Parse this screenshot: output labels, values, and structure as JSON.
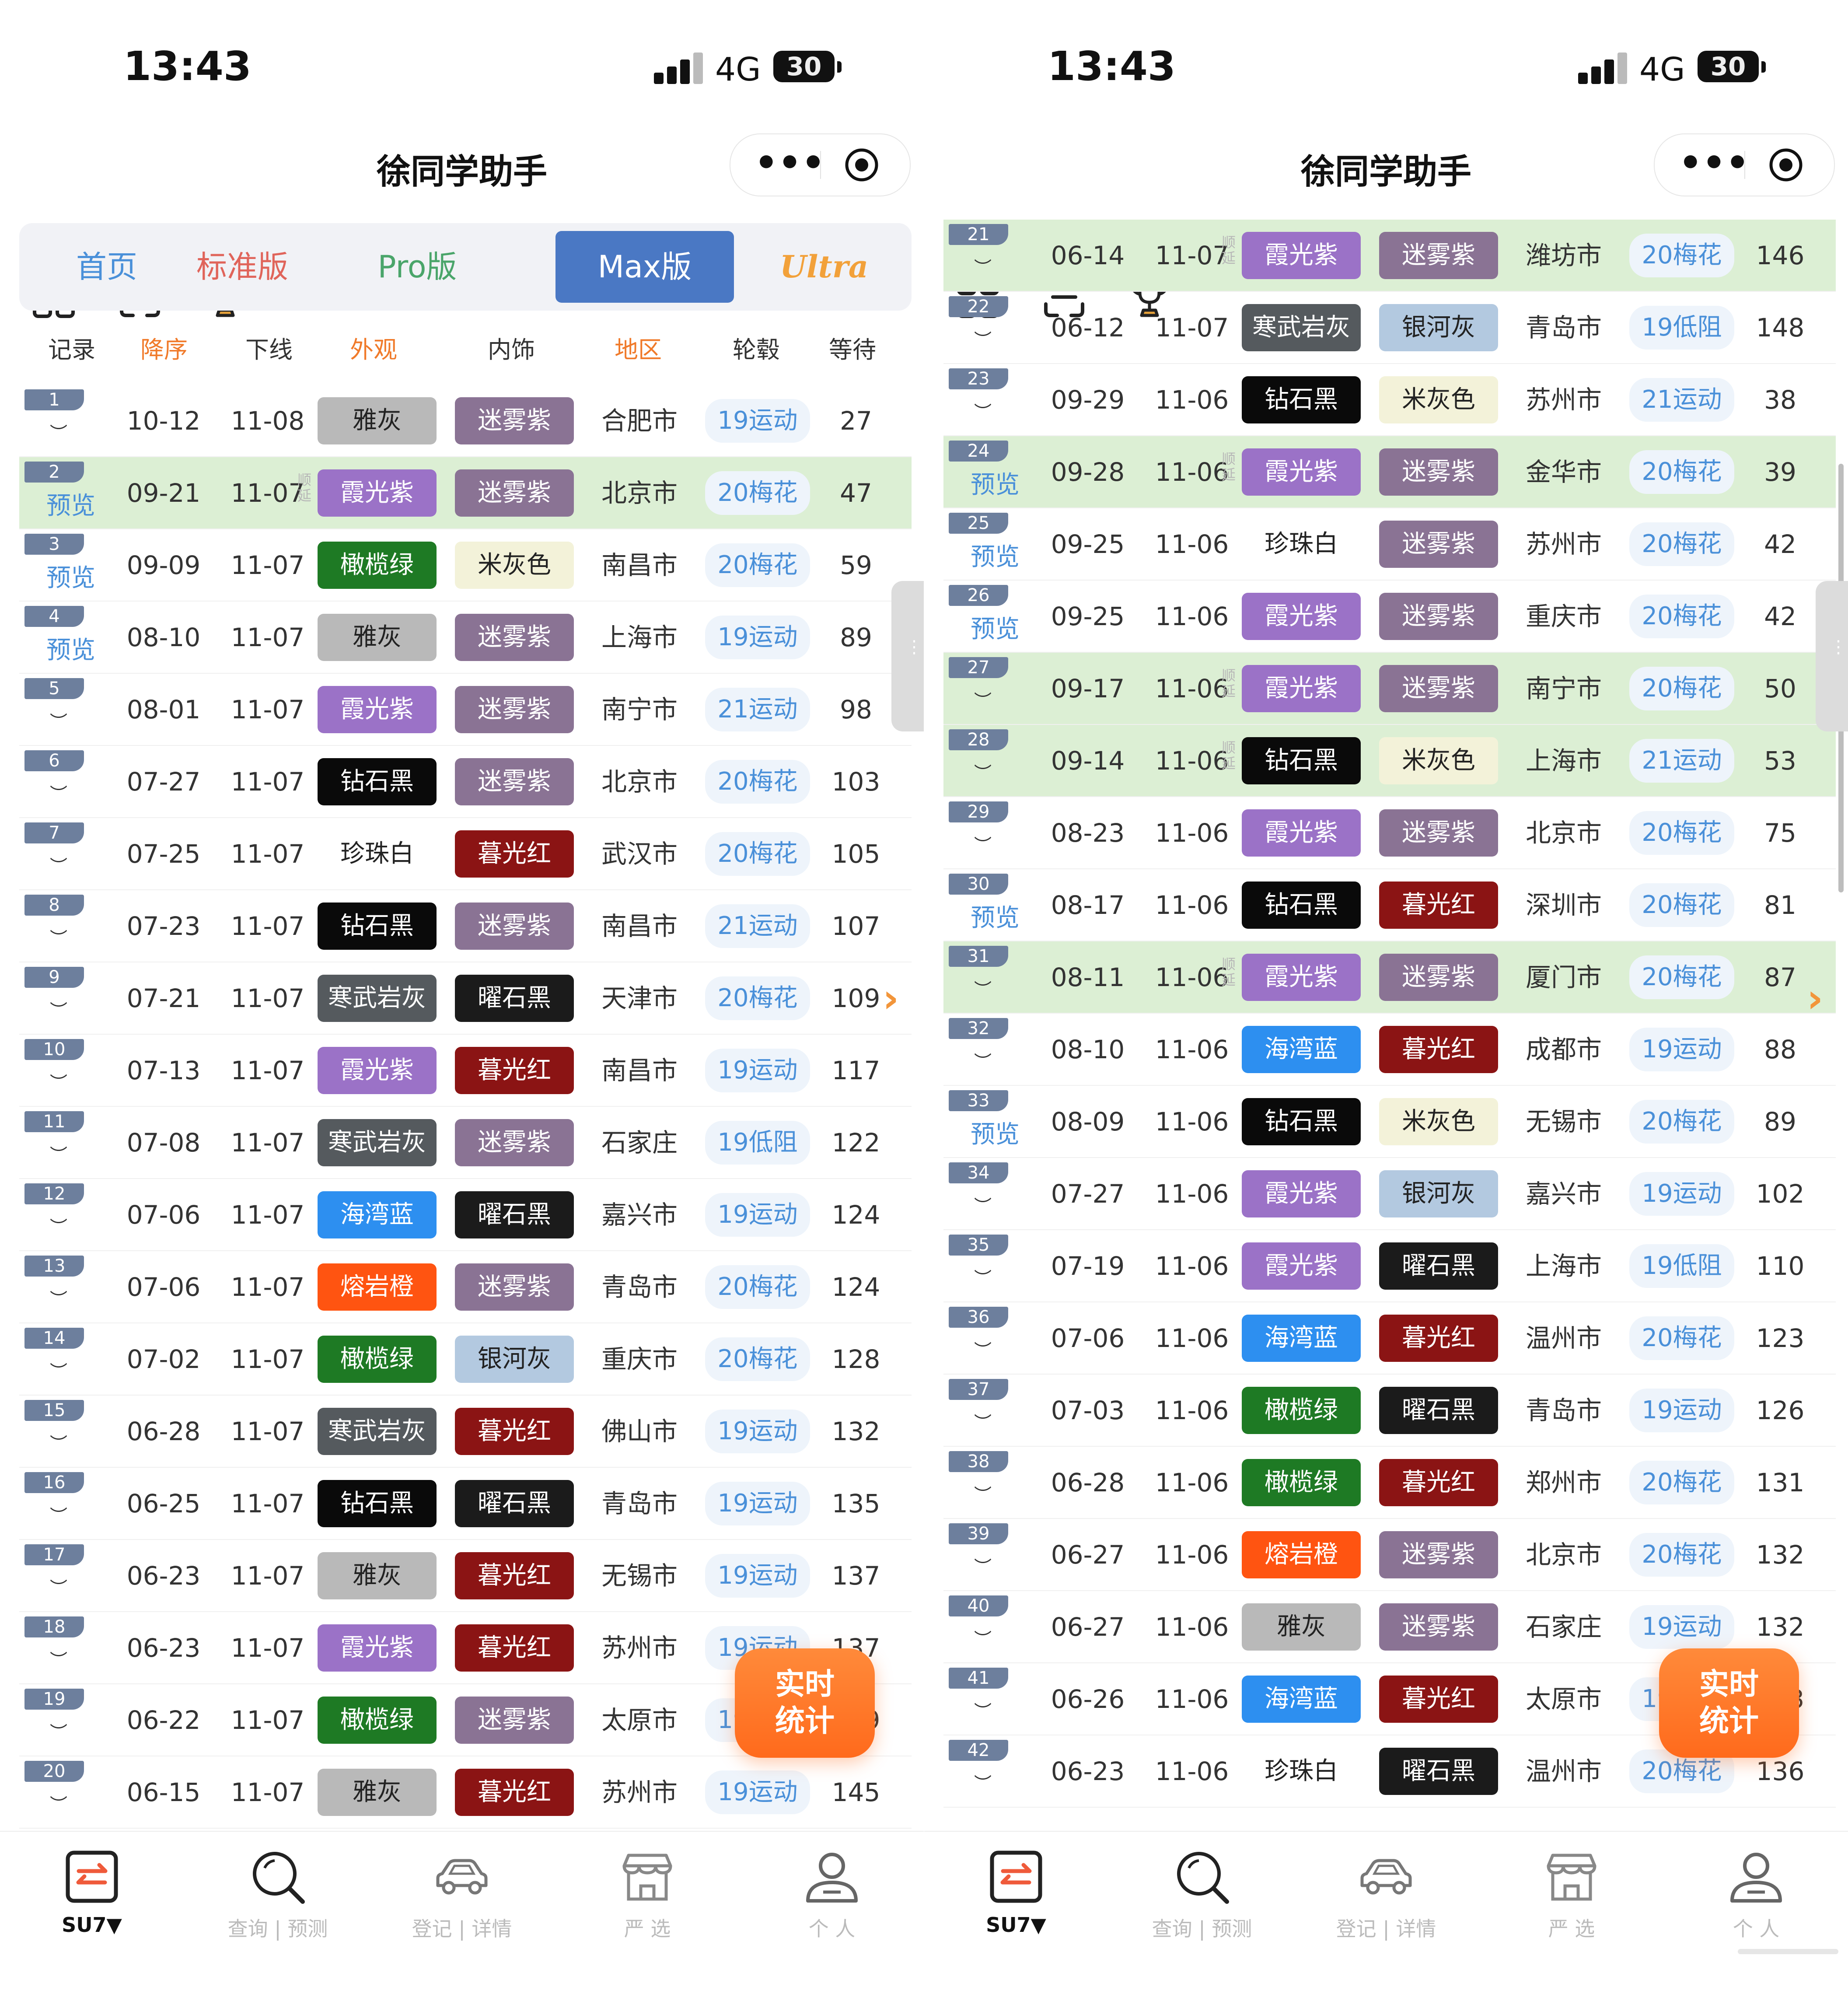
{
  "status": {
    "time": "13:43",
    "network": "4G",
    "battery": "30"
  },
  "nav": {
    "title": "徐同学助手",
    "more": "•••"
  },
  "tabs": [
    "首页",
    "标准版",
    "Pro版",
    "Max版",
    "Ultra"
  ],
  "headers": [
    "记录",
    "降序",
    "下线",
    "外观",
    "内饰",
    "地区",
    "轮毂",
    "等待"
  ],
  "labels": {
    "preview": "预览",
    "delay": "顺延",
    "fab_line1": "实时",
    "fab_line2": "统计"
  },
  "bottom_nav": [
    "SU7▼",
    "查询 | 预测",
    "登记 | 详情",
    "严 选",
    "个 人"
  ],
  "colors": {
    "tab_active": "#4a78c4",
    "highlight_row": "#dcefd4",
    "accent_orange": "#ff7a2a",
    "wheel_blue": "#4a90d9",
    "霞光紫": "#9b72c7",
    "迷雾紫": "#8a7394",
    "雅灰": "#b9b9b9",
    "橄榄绿": "#1e7a24",
    "米灰色": "#f2f2dc",
    "钻石黑": "#0a0a0a",
    "珍珠白": "#ffffff",
    "暮光红": "#8b1414",
    "寒武岩灰": "#555a5e",
    "曜石黑": "#1b1b1b",
    "海湾蓝": "#2d8ff0",
    "熔岩橙": "#ff5411",
    "银河灰": "#b3c9e0"
  },
  "left_rows": [
    {
      "no": "1",
      "mode": "eye",
      "order": "10-12",
      "offline": "11-08",
      "exterior": "雅灰",
      "interior": "迷雾紫",
      "region": "合肥市",
      "wheel": "19运动",
      "wait": "27",
      "hl": false,
      "delay": false
    },
    {
      "no": "2",
      "mode": "preview",
      "order": "09-21",
      "offline": "11-07",
      "exterior": "霞光紫",
      "interior": "迷雾紫",
      "region": "北京市",
      "wheel": "20梅花",
      "wait": "47",
      "hl": true,
      "delay": true
    },
    {
      "no": "3",
      "mode": "preview",
      "order": "09-09",
      "offline": "11-07",
      "exterior": "橄榄绿",
      "interior": "米灰色",
      "region": "南昌市",
      "wheel": "20梅花",
      "wait": "59",
      "hl": false,
      "delay": false
    },
    {
      "no": "4",
      "mode": "preview",
      "order": "08-10",
      "offline": "11-07",
      "exterior": "雅灰",
      "interior": "迷雾紫",
      "region": "上海市",
      "wheel": "19运动",
      "wait": "89",
      "hl": false,
      "delay": false
    },
    {
      "no": "5",
      "mode": "eye",
      "order": "08-01",
      "offline": "11-07",
      "exterior": "霞光紫",
      "interior": "迷雾紫",
      "region": "南宁市",
      "wheel": "21运动",
      "wait": "98",
      "hl": false,
      "delay": false
    },
    {
      "no": "6",
      "mode": "eye",
      "order": "07-27",
      "offline": "11-07",
      "exterior": "钻石黑",
      "interior": "迷雾紫",
      "region": "北京市",
      "wheel": "20梅花",
      "wait": "103",
      "hl": false,
      "delay": false
    },
    {
      "no": "7",
      "mode": "eye",
      "order": "07-25",
      "offline": "11-07",
      "exterior": "珍珠白",
      "interior": "暮光红",
      "region": "武汉市",
      "wheel": "20梅花",
      "wait": "105",
      "hl": false,
      "delay": false
    },
    {
      "no": "8",
      "mode": "eye",
      "order": "07-23",
      "offline": "11-07",
      "exterior": "钻石黑",
      "interior": "迷雾紫",
      "region": "南昌市",
      "wheel": "21运动",
      "wait": "107",
      "hl": false,
      "delay": false
    },
    {
      "no": "9",
      "mode": "eye",
      "order": "07-21",
      "offline": "11-07",
      "exterior": "寒武岩灰",
      "interior": "曜石黑",
      "region": "天津市",
      "wheel": "20梅花",
      "wait": "109",
      "hl": false,
      "delay": false
    },
    {
      "no": "10",
      "mode": "eye",
      "order": "07-13",
      "offline": "11-07",
      "exterior": "霞光紫",
      "interior": "暮光红",
      "region": "南昌市",
      "wheel": "19运动",
      "wait": "117",
      "hl": false,
      "delay": false
    },
    {
      "no": "11",
      "mode": "eye",
      "order": "07-08",
      "offline": "11-07",
      "exterior": "寒武岩灰",
      "interior": "迷雾紫",
      "region": "石家庄",
      "wheel": "19低阻",
      "wait": "122",
      "hl": false,
      "delay": false
    },
    {
      "no": "12",
      "mode": "eye",
      "order": "07-06",
      "offline": "11-07",
      "exterior": "海湾蓝",
      "interior": "曜石黑",
      "region": "嘉兴市",
      "wheel": "19运动",
      "wait": "124",
      "hl": false,
      "delay": false
    },
    {
      "no": "13",
      "mode": "eye",
      "order": "07-06",
      "offline": "11-07",
      "exterior": "熔岩橙",
      "interior": "迷雾紫",
      "region": "青岛市",
      "wheel": "20梅花",
      "wait": "124",
      "hl": false,
      "delay": false
    },
    {
      "no": "14",
      "mode": "eye",
      "order": "07-02",
      "offline": "11-07",
      "exterior": "橄榄绿",
      "interior": "银河灰",
      "region": "重庆市",
      "wheel": "20梅花",
      "wait": "128",
      "hl": false,
      "delay": false
    },
    {
      "no": "15",
      "mode": "eye",
      "order": "06-28",
      "offline": "11-07",
      "exterior": "寒武岩灰",
      "interior": "暮光红",
      "region": "佛山市",
      "wheel": "19运动",
      "wait": "132",
      "hl": false,
      "delay": false
    },
    {
      "no": "16",
      "mode": "eye",
      "order": "06-25",
      "offline": "11-07",
      "exterior": "钻石黑",
      "interior": "曜石黑",
      "region": "青岛市",
      "wheel": "19运动",
      "wait": "135",
      "hl": false,
      "delay": false
    },
    {
      "no": "17",
      "mode": "eye",
      "order": "06-23",
      "offline": "11-07",
      "exterior": "雅灰",
      "interior": "暮光红",
      "region": "无锡市",
      "wheel": "19运动",
      "wait": "137",
      "hl": false,
      "delay": false
    },
    {
      "no": "18",
      "mode": "eye",
      "order": "06-23",
      "offline": "11-07",
      "exterior": "霞光紫",
      "interior": "暮光红",
      "region": "苏州市",
      "wheel": "19运动",
      "wait": "137",
      "hl": false,
      "delay": false
    },
    {
      "no": "19",
      "mode": "eye",
      "order": "06-22",
      "offline": "11-07",
      "exterior": "橄榄绿",
      "interior": "迷雾紫",
      "region": "太原市",
      "wheel": "19运动",
      "wait": "139",
      "hl": false,
      "delay": false
    },
    {
      "no": "20",
      "mode": "eye",
      "order": "06-15",
      "offline": "11-07",
      "exterior": "雅灰",
      "interior": "暮光红",
      "region": "苏州市",
      "wheel": "19运动",
      "wait": "145",
      "hl": false,
      "delay": false
    }
  ],
  "right_rows": [
    {
      "no": "21",
      "mode": "eye",
      "order": "06-14",
      "offline": "11-07",
      "exterior": "霞光紫",
      "interior": "迷雾紫",
      "region": "潍坊市",
      "wheel": "20梅花",
      "wait": "146",
      "hl": true,
      "delay": true
    },
    {
      "no": "22",
      "mode": "eye",
      "order": "06-12",
      "offline": "11-07",
      "exterior": "寒武岩灰",
      "interior": "银河灰",
      "region": "青岛市",
      "wheel": "19低阻",
      "wait": "148",
      "hl": false,
      "delay": false
    },
    {
      "no": "23",
      "mode": "eye",
      "order": "09-29",
      "offline": "11-06",
      "exterior": "钻石黑",
      "interior": "米灰色",
      "region": "苏州市",
      "wheel": "21运动",
      "wait": "38",
      "hl": false,
      "delay": false
    },
    {
      "no": "24",
      "mode": "preview",
      "order": "09-28",
      "offline": "11-06",
      "exterior": "霞光紫",
      "interior": "迷雾紫",
      "region": "金华市",
      "wheel": "20梅花",
      "wait": "39",
      "hl": true,
      "delay": true
    },
    {
      "no": "25",
      "mode": "preview",
      "order": "09-25",
      "offline": "11-06",
      "exterior": "珍珠白",
      "interior": "迷雾紫",
      "region": "苏州市",
      "wheel": "20梅花",
      "wait": "42",
      "hl": false,
      "delay": false
    },
    {
      "no": "26",
      "mode": "preview",
      "order": "09-25",
      "offline": "11-06",
      "exterior": "霞光紫",
      "interior": "迷雾紫",
      "region": "重庆市",
      "wheel": "20梅花",
      "wait": "42",
      "hl": false,
      "delay": false
    },
    {
      "no": "27",
      "mode": "eye",
      "order": "09-17",
      "offline": "11-06",
      "exterior": "霞光紫",
      "interior": "迷雾紫",
      "region": "南宁市",
      "wheel": "20梅花",
      "wait": "50",
      "hl": true,
      "delay": true
    },
    {
      "no": "28",
      "mode": "eye",
      "order": "09-14",
      "offline": "11-06",
      "exterior": "钻石黑",
      "interior": "米灰色",
      "region": "上海市",
      "wheel": "21运动",
      "wait": "53",
      "hl": true,
      "delay": true
    },
    {
      "no": "29",
      "mode": "eye",
      "order": "08-23",
      "offline": "11-06",
      "exterior": "霞光紫",
      "interior": "迷雾紫",
      "region": "北京市",
      "wheel": "20梅花",
      "wait": "75",
      "hl": false,
      "delay": false
    },
    {
      "no": "30",
      "mode": "preview",
      "order": "08-17",
      "offline": "11-06",
      "exterior": "钻石黑",
      "interior": "暮光红",
      "region": "深圳市",
      "wheel": "20梅花",
      "wait": "81",
      "hl": false,
      "delay": false
    },
    {
      "no": "31",
      "mode": "eye",
      "order": "08-11",
      "offline": "11-06",
      "exterior": "霞光紫",
      "interior": "迷雾紫",
      "region": "厦门市",
      "wheel": "20梅花",
      "wait": "87",
      "hl": true,
      "delay": true
    },
    {
      "no": "32",
      "mode": "eye",
      "order": "08-10",
      "offline": "11-06",
      "exterior": "海湾蓝",
      "interior": "暮光红",
      "region": "成都市",
      "wheel": "19运动",
      "wait": "88",
      "hl": false,
      "delay": false
    },
    {
      "no": "33",
      "mode": "preview",
      "order": "08-09",
      "offline": "11-06",
      "exterior": "钻石黑",
      "interior": "米灰色",
      "region": "无锡市",
      "wheel": "20梅花",
      "wait": "89",
      "hl": false,
      "delay": false
    },
    {
      "no": "34",
      "mode": "eye",
      "order": "07-27",
      "offline": "11-06",
      "exterior": "霞光紫",
      "interior": "银河灰",
      "region": "嘉兴市",
      "wheel": "19运动",
      "wait": "102",
      "hl": false,
      "delay": false
    },
    {
      "no": "35",
      "mode": "eye",
      "order": "07-19",
      "offline": "11-06",
      "exterior": "霞光紫",
      "interior": "曜石黑",
      "region": "上海市",
      "wheel": "19低阻",
      "wait": "110",
      "hl": false,
      "delay": false
    },
    {
      "no": "36",
      "mode": "eye",
      "order": "07-06",
      "offline": "11-06",
      "exterior": "海湾蓝",
      "interior": "暮光红",
      "region": "温州市",
      "wheel": "20梅花",
      "wait": "123",
      "hl": false,
      "delay": false
    },
    {
      "no": "37",
      "mode": "eye",
      "order": "07-03",
      "offline": "11-06",
      "exterior": "橄榄绿",
      "interior": "曜石黑",
      "region": "青岛市",
      "wheel": "19运动",
      "wait": "126",
      "hl": false,
      "delay": false
    },
    {
      "no": "38",
      "mode": "eye",
      "order": "06-28",
      "offline": "11-06",
      "exterior": "橄榄绿",
      "interior": "暮光红",
      "region": "郑州市",
      "wheel": "20梅花",
      "wait": "131",
      "hl": false,
      "delay": false
    },
    {
      "no": "39",
      "mode": "eye",
      "order": "06-27",
      "offline": "11-06",
      "exterior": "熔岩橙",
      "interior": "迷雾紫",
      "region": "北京市",
      "wheel": "20梅花",
      "wait": "132",
      "hl": false,
      "delay": false
    },
    {
      "no": "40",
      "mode": "eye",
      "order": "06-27",
      "offline": "11-06",
      "exterior": "雅灰",
      "interior": "迷雾紫",
      "region": "石家庄",
      "wheel": "19运动",
      "wait": "132",
      "hl": false,
      "delay": false
    },
    {
      "no": "41",
      "mode": "eye",
      "order": "06-26",
      "offline": "11-06",
      "exterior": "海湾蓝",
      "interior": "暮光红",
      "region": "太原市",
      "wheel": "19运动",
      "wait": "133",
      "hl": false,
      "delay": false
    },
    {
      "no": "42",
      "mode": "eye",
      "order": "06-23",
      "offline": "11-06",
      "exterior": "珍珠白",
      "interior": "曜石黑",
      "region": "温州市",
      "wheel": "20梅花",
      "wait": "136",
      "hl": false,
      "delay": false
    }
  ]
}
